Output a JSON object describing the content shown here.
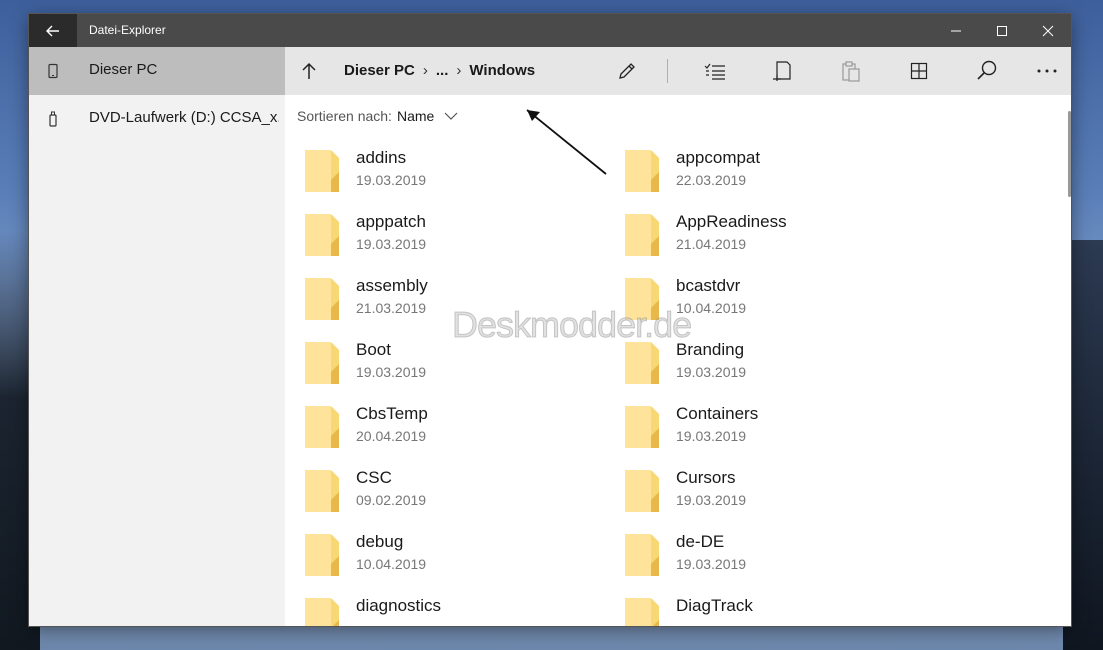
{
  "window": {
    "title": "Datei-Explorer"
  },
  "sidebar": {
    "items": [
      {
        "label": "Dieser PC",
        "icon": "phone-icon",
        "selected": true
      },
      {
        "label": "DVD-Laufwerk (D:) CCSA_x...",
        "icon": "usb-drive-icon",
        "selected": false
      }
    ]
  },
  "toolbar": {
    "breadcrumb": [
      "Dieser PC",
      "...",
      "Windows"
    ],
    "separator": "›",
    "buttons": [
      "up-arrow-icon",
      "rename-icon",
      "select-icon",
      "new-folder-icon",
      "paste-icon",
      "view-icon",
      "search-icon",
      "more-icon"
    ]
  },
  "sort": {
    "label": "Sortieren nach:",
    "value": "Name"
  },
  "files": [
    {
      "name": "addins",
      "date": "19.03.2019"
    },
    {
      "name": "appcompat",
      "date": "22.03.2019"
    },
    {
      "name": "apppatch",
      "date": "19.03.2019"
    },
    {
      "name": "AppReadiness",
      "date": "21.04.2019"
    },
    {
      "name": "assembly",
      "date": "21.03.2019"
    },
    {
      "name": "bcastdvr",
      "date": "10.04.2019"
    },
    {
      "name": "Boot",
      "date": "19.03.2019"
    },
    {
      "name": "Branding",
      "date": "19.03.2019"
    },
    {
      "name": "CbsTemp",
      "date": "20.04.2019"
    },
    {
      "name": "Containers",
      "date": "19.03.2019"
    },
    {
      "name": "CSC",
      "date": "09.02.2019"
    },
    {
      "name": "Cursors",
      "date": "19.03.2019"
    },
    {
      "name": "debug",
      "date": "10.04.2019"
    },
    {
      "name": "de-DE",
      "date": "19.03.2019"
    },
    {
      "name": "diagnostics",
      "date": ""
    },
    {
      "name": "DiagTrack",
      "date": ""
    }
  ],
  "watermark": "Deskmodder.de",
  "colors": {
    "titlebar": "#4a4a4a",
    "sidebar": "#f2f2f2",
    "sidebar_selected": "#bdbdbd",
    "toolbar": "#e6e6e6",
    "folder": "#f8d775"
  }
}
